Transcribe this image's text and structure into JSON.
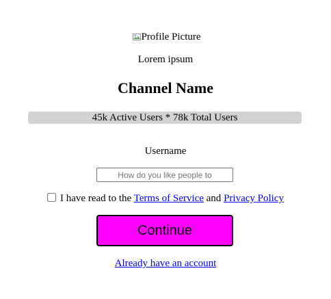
{
  "profile": {
    "image_alt": "Profile Picture",
    "broken_image_icon": "broken-image-icon"
  },
  "subtitle": "Lorem ipsum",
  "channel_name": "Channel Name",
  "stats": {
    "active_users": "45k",
    "active_label": "Active Users",
    "separator": "*",
    "total_users": "78k",
    "total_label": "Total Users",
    "text": "45k Active Users * 78k Total Users",
    "background_color": "#d3d3d3"
  },
  "username": {
    "label": "Username",
    "value": "",
    "placeholder": "How do you like people to"
  },
  "terms": {
    "checked": false,
    "prefix": "I have read to the",
    "terms_link": "Terms of Service",
    "conjunction": "and",
    "privacy_link": "Privacy Policy"
  },
  "continue_button": {
    "label": "Continue",
    "color": "#ff00ff"
  },
  "login_link": "Already have an account",
  "colors": {
    "link": "#0000ee",
    "accent": "#ff00ff"
  }
}
